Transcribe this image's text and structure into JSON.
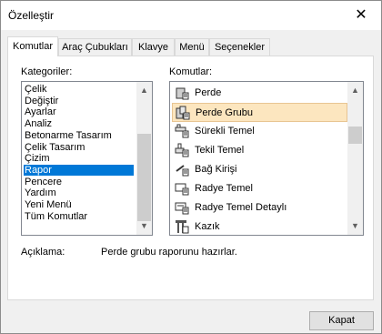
{
  "window": {
    "title": "Özelleştir",
    "close_glyph": "✕"
  },
  "tabs": [
    "Komutlar",
    "Araç Çubukları",
    "Klavye",
    "Menü",
    "Seçenekler"
  ],
  "categories": {
    "label": "Kategoriler:",
    "items": [
      "Çelik",
      "Değiştir",
      "Ayarlar",
      "Analiz",
      "Betonarme Tasarım",
      "Çelik Tasarım",
      "Çizim",
      "Rapor",
      "Pencere",
      "Yardım",
      "Yeni Menü",
      "Tüm Komutlar"
    ],
    "selected": "Rapor"
  },
  "commands": {
    "label": "Komutlar:",
    "items": [
      {
        "label": "Perde",
        "icon": "wall-icon"
      },
      {
        "label": "Perde Grubu",
        "icon": "wall-group-icon"
      },
      {
        "label": "Sürekli Temel",
        "icon": "continuous-footing-icon"
      },
      {
        "label": "Tekil Temel",
        "icon": "single-footing-icon"
      },
      {
        "label": "Bağ Kirişi",
        "icon": "tie-beam-icon"
      },
      {
        "label": "Radye Temel",
        "icon": "raft-foundation-icon"
      },
      {
        "label": "Radye Temel Detaylı",
        "icon": "raft-foundation-detail-icon"
      },
      {
        "label": "Kazık",
        "icon": "pile-icon"
      }
    ],
    "highlighted": "Perde Grubu"
  },
  "description": {
    "label": "Açıklama:",
    "text": "Perde grubu raporunu hazırlar."
  },
  "buttons": {
    "close": "Kapat"
  }
}
